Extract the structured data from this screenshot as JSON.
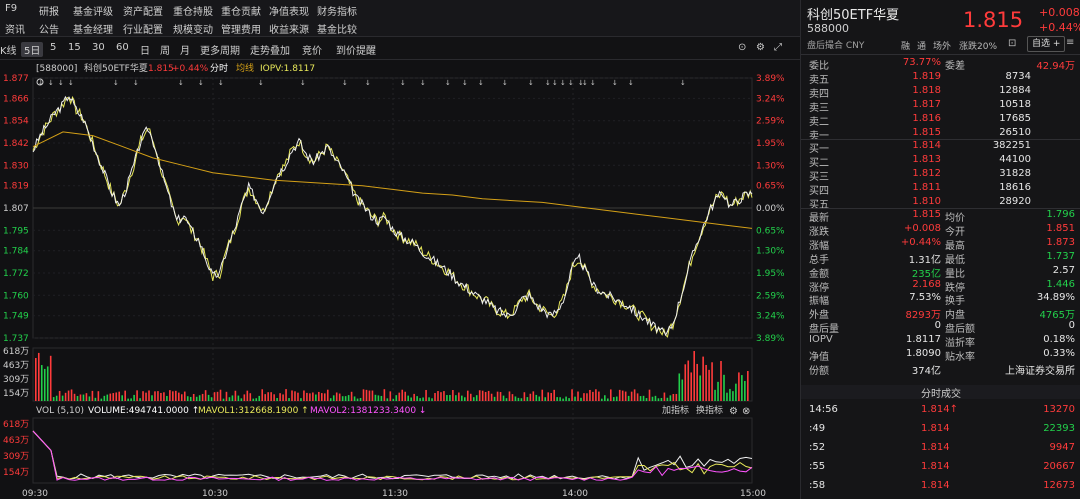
{
  "toolbar1": {
    "items": [
      "F9",
      "研报",
      "基金评级",
      "资产配置",
      "重仓持股",
      "重仓贡献",
      "净值表现",
      "财务指标"
    ]
  },
  "toolbar2": {
    "items": [
      "资讯",
      "公告",
      "基金经理",
      "行业配置",
      "规模变动",
      "管理费用",
      "收益来源",
      "基金比较"
    ]
  },
  "toolbar3": {
    "items": [
      "K线",
      "5日",
      "5",
      "15",
      "30",
      "60",
      "日",
      "周",
      "月",
      "更多周期",
      "走势叠加",
      "竞价",
      "到价提醒"
    ],
    "selected": "分时"
  },
  "chart_header": {
    "code": "[588000]",
    "name": "科创50ETF华夏",
    "price": "1.815",
    "change": "+0.44%",
    "mode": "分时",
    "avg_label": "均线",
    "iopv": "IOPV:1.8117"
  },
  "price_axis": {
    "left": [
      "1.877",
      "1.866",
      "1.854",
      "1.842",
      "1.830",
      "1.819",
      "1.807",
      "1.795",
      "1.784",
      "1.772",
      "1.760",
      "1.749",
      "1.737"
    ],
    "right": [
      "3.89%",
      "3.24%",
      "2.59%",
      "1.95%",
      "1.30%",
      "0.65%",
      "0.00%",
      "0.65%",
      "1.30%",
      "1.95%",
      "2.59%",
      "3.24%",
      "3.89%"
    ]
  },
  "volume_axis": [
    "618万",
    "463万",
    "309万",
    "154万"
  ],
  "vol_header": {
    "title": "VOL (5,10)",
    "volume": "VOLUME:494741.0000",
    "mavol1": "MAVOL1:312668.1900",
    "mavol2": "MAVOL2:1381233.3400",
    "add_indicator": "加指标",
    "switch_indicator": "换指标"
  },
  "time_axis": [
    "09:30",
    "10:30",
    "11:30",
    "14:00",
    "15:00"
  ],
  "quote": {
    "name": "科创50ETF华夏",
    "code": "588000",
    "price": "1.815",
    "change": "+0.008",
    "change_pct": "+0.44%",
    "sub": "盘后撮合 CNY",
    "tags": [
      "融",
      "通",
      "场外",
      "涨跌20%"
    ],
    "watch_btn": "自选 +",
    "weibi_label": "委比",
    "weibi": "73.77%",
    "weicha_label": "委差",
    "weicha": "42.94万",
    "asks": [
      {
        "label": "卖五",
        "price": "1.819",
        "vol": "8734"
      },
      {
        "label": "卖四",
        "price": "1.818",
        "vol": "12884"
      },
      {
        "label": "卖三",
        "price": "1.817",
        "vol": "10518"
      },
      {
        "label": "卖二",
        "price": "1.816",
        "vol": "17685"
      },
      {
        "label": "卖一",
        "price": "1.815",
        "vol": "26510"
      }
    ],
    "bids": [
      {
        "label": "买一",
        "price": "1.814",
        "vol": "382251"
      },
      {
        "label": "买二",
        "price": "1.813",
        "vol": "44100"
      },
      {
        "label": "买三",
        "price": "1.812",
        "vol": "31828"
      },
      {
        "label": "买四",
        "price": "1.811",
        "vol": "18616"
      },
      {
        "label": "买五",
        "price": "1.810",
        "vol": "28920"
      }
    ],
    "stats": [
      [
        {
          "l": "最新",
          "v": "1.815",
          "c": "red"
        },
        {
          "l": "均价",
          "v": "1.796",
          "c": "green"
        }
      ],
      [
        {
          "l": "涨跌",
          "v": "+0.008",
          "c": "red"
        },
        {
          "l": "今开",
          "v": "1.851",
          "c": "red"
        }
      ],
      [
        {
          "l": "涨幅",
          "v": "+0.44%",
          "c": "red"
        },
        {
          "l": "最高",
          "v": "1.873",
          "c": "red"
        }
      ],
      [
        {
          "l": "总手",
          "v": "1.31亿",
          "c": "white"
        },
        {
          "l": "最低",
          "v": "1.737",
          "c": "green"
        }
      ],
      [
        {
          "l": "金额",
          "v": "235亿",
          "c": "green"
        },
        {
          "l": "量比",
          "v": "2.57",
          "c": "white"
        }
      ],
      [
        {
          "l": "涨停",
          "v": "2.168",
          "c": "red"
        },
        {
          "l": "跌停",
          "v": "1.446",
          "c": "green"
        }
      ],
      [
        {
          "l": "振幅",
          "v": "7.53%",
          "c": "white"
        },
        {
          "l": "换手",
          "v": "34.89%",
          "c": "white"
        }
      ],
      [
        {
          "l": "外盘",
          "v": "8293万",
          "c": "red"
        },
        {
          "l": "内盘",
          "v": "4765万",
          "c": "green"
        }
      ],
      [
        {
          "l": "盘后量",
          "v": "0",
          "c": "white"
        },
        {
          "l": "盘后额",
          "v": "0",
          "c": "white"
        }
      ],
      [
        {
          "l": "IOPV",
          "v": "1.8117",
          "c": "white"
        },
        {
          "l": "溢折率",
          "v": "0.18%",
          "c": "white"
        }
      ],
      [
        {
          "l": "净值",
          "v": "1.8090",
          "c": "white"
        },
        {
          "l": "贴水率",
          "v": "0.33%",
          "c": "white"
        }
      ],
      [
        {
          "l": "份额",
          "v": "374亿",
          "c": "white"
        },
        {
          "l": "",
          "v": "上海证券交易所",
          "c": "white"
        }
      ]
    ],
    "tape_title": "分时成交",
    "tape": [
      {
        "time": "14:56",
        "price": "1.814",
        "arrow": "↑",
        "vol": "13270",
        "vc": "red"
      },
      {
        "time": ":49",
        "price": "1.814",
        "arrow": "",
        "vol": "22393",
        "vc": "green"
      },
      {
        "time": ":52",
        "price": "1.814",
        "arrow": "",
        "vol": "9947",
        "vc": "red"
      },
      {
        "time": ":55",
        "price": "1.814",
        "arrow": "",
        "vol": "20667",
        "vc": "red"
      },
      {
        "time": ":58",
        "price": "1.814",
        "arrow": "",
        "vol": "12673",
        "vc": "red"
      }
    ]
  },
  "colors": {
    "price_line": "#f0f0f0",
    "avg_line": "#d4a017",
    "iopv_line": "#e8e85a",
    "up": "#ff3b3b",
    "down": "#22d04b",
    "mavol1": "#e8e85a",
    "mavol2": "#ff55ff"
  }
}
